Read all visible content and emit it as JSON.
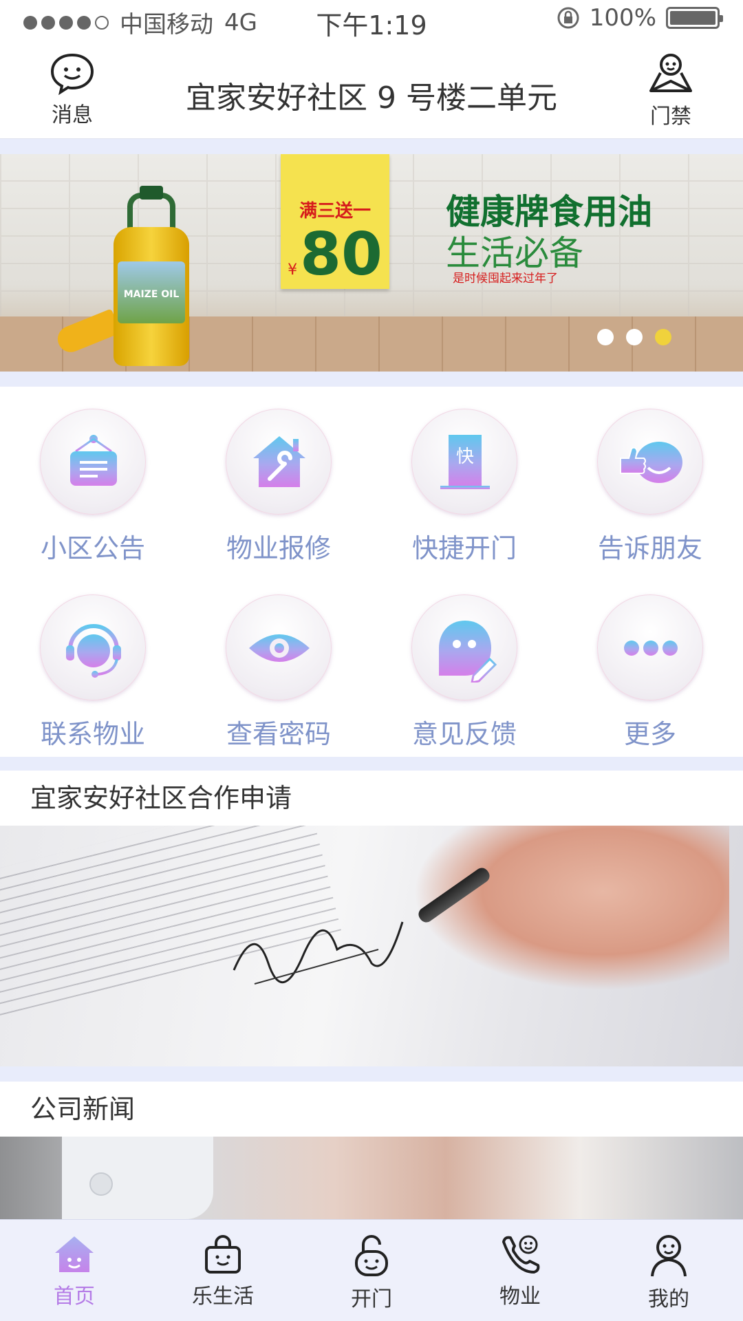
{
  "status_bar": {
    "carrier": "中国移动",
    "network": "4G",
    "time": "下午1:19",
    "battery": "100%",
    "signal_bars": 4
  },
  "header": {
    "title": "宜家安好社区 9 号楼二单元",
    "left_button": "消息",
    "right_button": "门禁"
  },
  "banner": {
    "promo_line": "满三送一",
    "price_symbol": "¥",
    "price": "80",
    "headline": "健康牌食用油",
    "subheadline": "生活必备",
    "caption": "是时候囤起来过年了",
    "bottle_label": "MAIZE OIL",
    "active_slide": 3,
    "slides": 3
  },
  "grid": [
    {
      "label": "小区公告",
      "icon": "notice-board-icon"
    },
    {
      "label": "物业报修",
      "icon": "house-wrench-icon"
    },
    {
      "label": "快捷开门",
      "icon": "quick-door-icon"
    },
    {
      "label": "告诉朋友",
      "icon": "thumbs-up-icon"
    },
    {
      "label": "联系物业",
      "icon": "headset-icon"
    },
    {
      "label": "查看密码",
      "icon": "eye-icon"
    },
    {
      "label": "意见反馈",
      "icon": "feedback-icon"
    },
    {
      "label": "更多",
      "icon": "more-icon"
    }
  ],
  "quick_door_char": "快",
  "sections": [
    {
      "title": "宜家安好社区合作申请"
    },
    {
      "title": "公司新闻"
    }
  ],
  "tabbar": [
    {
      "label": "首页",
      "icon": "home-icon",
      "active": true
    },
    {
      "label": "乐生活",
      "icon": "shopping-bag-icon",
      "active": false
    },
    {
      "label": "开门",
      "icon": "unlock-icon",
      "active": false
    },
    {
      "label": "物业",
      "icon": "phone-icon",
      "active": false
    },
    {
      "label": "我的",
      "icon": "person-icon",
      "active": false
    }
  ],
  "colors": {
    "accent": "#b47be6",
    "grid_label": "#7f93c9",
    "background": "#e8ecfb"
  }
}
